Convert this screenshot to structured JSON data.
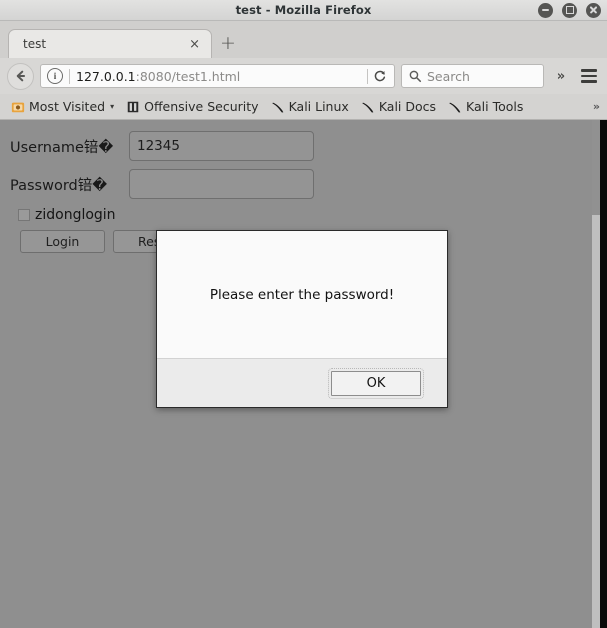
{
  "window": {
    "title": "test - Mozilla Firefox",
    "controls": [
      {
        "name": "minimize",
        "glyph": "minimize-icon"
      },
      {
        "name": "maximize",
        "glyph": "maximize-icon"
      },
      {
        "name": "close",
        "glyph": "close-icon"
      }
    ]
  },
  "tabs": {
    "items": [
      {
        "label": "test",
        "close_label": "×"
      }
    ],
    "new_tab_label": "+"
  },
  "toolbar": {
    "back_icon": "back-arrow-icon",
    "identity_icon": "info-icon",
    "identity_glyph": "i",
    "url_host": "127.0.0.1",
    "url_rest": ":8080/test1.html",
    "reload_icon": "reload-icon",
    "search_icon": "search-icon",
    "search_placeholder": "Search",
    "overflow_label": "»",
    "menu_icon": "hamburger-menu-icon"
  },
  "bookmarks": {
    "items": [
      {
        "label": "Most Visited",
        "icon": "most-visited-icon",
        "caret": "▾"
      },
      {
        "label": "Offensive Security",
        "icon": "offensive-security-icon",
        "caret": ""
      },
      {
        "label": "Kali Linux",
        "icon": "kali-dragon-icon",
        "caret": ""
      },
      {
        "label": "Kali Docs",
        "icon": "kali-dragon-icon",
        "caret": ""
      },
      {
        "label": "Kali Tools",
        "icon": "kali-dragon-icon",
        "caret": ""
      }
    ],
    "overflow_label": "»"
  },
  "page": {
    "fields": [
      {
        "label": "Username锫�",
        "value": "12345",
        "placeholder": ""
      },
      {
        "label": "Password锫�",
        "value": "",
        "placeholder": ""
      }
    ],
    "checkbox": {
      "label": "zidonglogin",
      "checked": false
    },
    "buttons": [
      {
        "label": "Login"
      },
      {
        "label": "Reset"
      }
    ]
  },
  "dialog": {
    "message": "Please enter the password!",
    "ok_label": "OK"
  },
  "colors": {
    "page_background": "#8f8f8f",
    "chrome_background": "#d4d3d1",
    "dialog_background": "#fafafa",
    "bookmark_accent": "#e8a33d"
  }
}
